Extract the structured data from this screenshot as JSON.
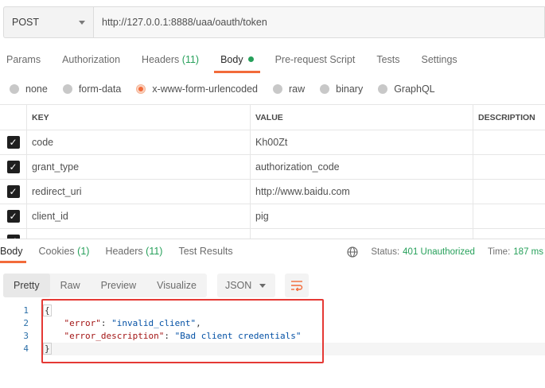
{
  "request": {
    "method": "POST",
    "url": "http://127.0.0.1:8888/uaa/oauth/token"
  },
  "request_tabs": {
    "params": "Params",
    "authorization": "Authorization",
    "headers": "Headers",
    "headers_count": "(11)",
    "body": "Body",
    "prerequest": "Pre-request Script",
    "tests": "Tests",
    "settings": "Settings"
  },
  "body_types": {
    "none": "none",
    "form_data": "form-data",
    "urlencoded": "x-www-form-urlencoded",
    "raw": "raw",
    "binary": "binary",
    "graphql": "GraphQL",
    "selected": "x-www-form-urlencoded"
  },
  "table": {
    "headers": {
      "key": "KEY",
      "value": "VALUE",
      "description": "DESCRIPTION"
    },
    "rows": [
      {
        "key": "code",
        "value": "Kh00Zt",
        "checked": true
      },
      {
        "key": "grant_type",
        "value": "authorization_code",
        "checked": true
      },
      {
        "key": "redirect_uri",
        "value": "http://www.baidu.com",
        "checked": true
      },
      {
        "key": "client_id",
        "value": "pig",
        "checked": true
      }
    ]
  },
  "response_tabs": {
    "body": "Body",
    "cookies": "Cookies",
    "cookies_count": "(1)",
    "headers": "Headers",
    "headers_count": "(11)",
    "test_results": "Test Results"
  },
  "status": {
    "label": "Status:",
    "value": "401 Unauthorized",
    "time_label": "Time:",
    "time_value": "187 ms"
  },
  "response_toolbar": {
    "pretty": "Pretty",
    "raw": "Raw",
    "preview": "Preview",
    "visualize": "Visualize",
    "language": "JSON"
  },
  "editor": {
    "line_numbers": [
      "1",
      "2",
      "3",
      "4"
    ],
    "open_brace": "{",
    "close_brace": "}",
    "key1": "\"error\"",
    "val1": "\"invalid_client\"",
    "key2": "\"error_description\"",
    "val2": "\"Bad client credentials\""
  },
  "colors": {
    "accent": "#f26b3a",
    "success": "#26a05a",
    "highlight_box": "#e53935"
  }
}
